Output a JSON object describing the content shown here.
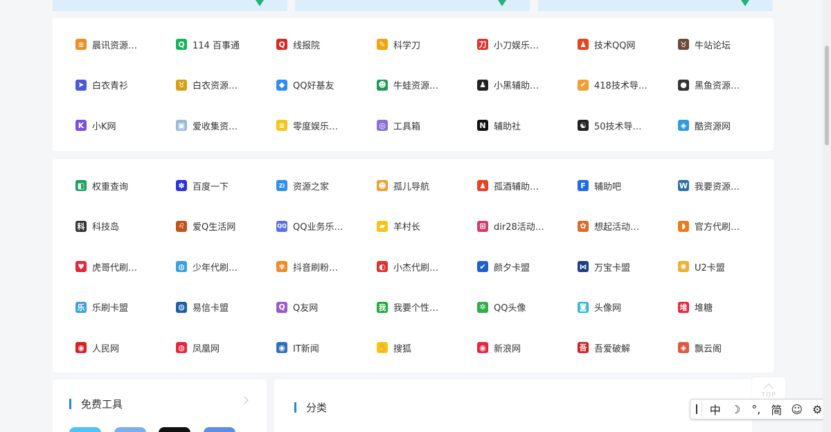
{
  "panel1": {
    "links": [
      {
        "label": "晨讯资源…",
        "icon": "sunrise-icon",
        "color": "#f08a24",
        "glyph": "≋"
      },
      {
        "label": "114 百事通",
        "icon": "circle-q-icon",
        "color": "#16b356",
        "glyph": "Q"
      },
      {
        "label": "线报院",
        "icon": "q-ring-icon",
        "color": "#d9281f",
        "glyph": "Q"
      },
      {
        "label": "科学刀",
        "icon": "pencil-icon",
        "color": "#f2a30f",
        "glyph": "✎"
      },
      {
        "label": "小刀娱乐…",
        "icon": "xiaodao-logo-icon",
        "color": "#e0312a",
        "glyph": "刀"
      },
      {
        "label": "技术QQ网",
        "icon": "penguin-icon",
        "color": "#e8421f",
        "glyph": "♟"
      },
      {
        "label": "牛站论坛",
        "icon": "bull-icon",
        "color": "#6b4a3a",
        "glyph": "♉"
      },
      {
        "label": "白衣青衫",
        "icon": "bird-icon",
        "color": "#4c5bd4",
        "glyph": "➤"
      },
      {
        "label": "白衣资源…",
        "icon": "bull-head-icon",
        "color": "#d4a017",
        "glyph": "♉"
      },
      {
        "label": "QQ好基友",
        "icon": "diamond-icon",
        "color": "#2f8ff0",
        "glyph": "◆"
      },
      {
        "label": "牛蛙资源…",
        "icon": "frog-icon",
        "color": "#1f9a57",
        "glyph": "☻"
      },
      {
        "label": "小黑辅助…",
        "icon": "hooded-figure-icon",
        "color": "#222222",
        "glyph": "♟"
      },
      {
        "label": "418技术导…",
        "icon": "check-badge-icon",
        "color": "#f0a030",
        "glyph": "✔"
      },
      {
        "label": "黑鱼资源…",
        "icon": "black-fish-icon",
        "color": "#333333",
        "glyph": "●"
      },
      {
        "label": "小K网",
        "icon": "k-letter-icon",
        "color": "#7a4ce0",
        "glyph": "K"
      },
      {
        "label": "爱收集资…",
        "icon": "broken-image-icon",
        "color": "#9cb8d8",
        "glyph": "▣"
      },
      {
        "label": "零度娱乐…",
        "icon": "note-icon",
        "color": "#f5c518",
        "glyph": "≡"
      },
      {
        "label": "工具箱",
        "icon": "planet-icon",
        "color": "#8a6fd6",
        "glyph": "◎"
      },
      {
        "label": "辅助社",
        "icon": "n-letter-icon",
        "color": "#111111",
        "glyph": "N"
      },
      {
        "label": "50技术导…",
        "icon": "yin-yang-icon",
        "color": "#222222",
        "glyph": "☯"
      },
      {
        "label": "酷资源网",
        "icon": "cube-icon",
        "color": "#2d9cdb",
        "glyph": "◈"
      }
    ]
  },
  "panel2": {
    "links": [
      {
        "label": "权重查询",
        "icon": "weight-check-icon",
        "color": "#1aa260",
        "glyph": "◧"
      },
      {
        "label": "百度一下",
        "icon": "baidu-paw-icon",
        "color": "#2932e1",
        "glyph": "✽"
      },
      {
        "label": "资源之家",
        "icon": "zi-letter-icon",
        "color": "#2f8ff0",
        "glyph": "Zi"
      },
      {
        "label": "孤儿导航",
        "icon": "tiger-icon",
        "color": "#f0a030",
        "glyph": "☻"
      },
      {
        "label": "孤酒辅助…",
        "icon": "penguin-icon",
        "color": "#e8421f",
        "glyph": "♟"
      },
      {
        "label": "辅助吧",
        "icon": "f-letter-icon",
        "color": "#1e6be8",
        "glyph": "F"
      },
      {
        "label": "我要资源…",
        "icon": "wordpress-icon",
        "color": "#2a6fa8",
        "glyph": "W"
      },
      {
        "label": "科技岛",
        "icon": "tech-island-icon",
        "color": "#333333",
        "glyph": "科"
      },
      {
        "label": "爱Q生活网",
        "icon": "lion-icon",
        "color": "#c0531b",
        "glyph": "♌"
      },
      {
        "label": "QQ业务乐…",
        "icon": "qq-letters-icon",
        "color": "#5a6fe0",
        "glyph": "QQ"
      },
      {
        "label": "羊村长",
        "icon": "sheep-card-icon",
        "color": "#f5c518",
        "glyph": "▰"
      },
      {
        "label": "dir28活动…",
        "icon": "gift-icon",
        "color": "#d63b6b",
        "glyph": "⊞"
      },
      {
        "label": "想起活动…",
        "icon": "pinwheel-icon",
        "color": "#e06a2a",
        "glyph": "✿"
      },
      {
        "label": "官方代刷…",
        "icon": "orange-tag-icon",
        "color": "#f07a18",
        "glyph": "◗"
      },
      {
        "label": "虎哥代刷…",
        "icon": "heart-icon",
        "color": "#e8263a",
        "glyph": "♥"
      },
      {
        "label": "少年代刷…",
        "icon": "globe-badge-icon",
        "color": "#3aa0d8",
        "glyph": "◍"
      },
      {
        "label": "抖音刷粉…",
        "icon": "flower-icon",
        "color": "#f08a24",
        "glyph": "✾"
      },
      {
        "label": "小杰代刷…",
        "icon": "swirl-icon",
        "color": "#e0312a",
        "glyph": "◐"
      },
      {
        "label": "颜夕卡盟",
        "icon": "v-check-icon",
        "color": "#1e5fd0",
        "glyph": "✔"
      },
      {
        "label": "万宝卡盟",
        "icon": "bowtie-icon",
        "color": "#1c3d8a",
        "glyph": "⋈"
      },
      {
        "label": "U2卡盟",
        "icon": "fan-icon",
        "color": "#f0b030",
        "glyph": "✺"
      },
      {
        "label": "乐刷卡盟",
        "icon": "lecard-icon",
        "color": "#3aa0d8",
        "glyph": "乐"
      },
      {
        "label": "易信卡盟",
        "icon": "swoosh-globe-icon",
        "color": "#1e5fa8",
        "glyph": "◍"
      },
      {
        "label": "Q友网",
        "icon": "q-square-icon",
        "color": "#9b59d0",
        "glyph": "Q"
      },
      {
        "label": "我要个性…",
        "icon": "wo-letter-icon",
        "color": "#1fa83a",
        "glyph": "我"
      },
      {
        "label": "QQ头像",
        "icon": "frog-leaf-icon",
        "color": "#2fb04a",
        "glyph": "✲"
      },
      {
        "label": "头像网",
        "icon": "chat-bubble-icon",
        "color": "#2bbcd0",
        "glyph": "◙"
      },
      {
        "label": "堆糖",
        "icon": "duitang-icon",
        "color": "#e8263a",
        "glyph": "堆"
      },
      {
        "label": "人民网",
        "icon": "renmin-logo-icon",
        "color": "#d61f1f",
        "glyph": "◉"
      },
      {
        "label": "凤凰网",
        "icon": "phoenix-icon",
        "color": "#e8263a",
        "glyph": "◍"
      },
      {
        "label": "IT新闻",
        "icon": "rss-icon",
        "color": "#2f6fc0",
        "glyph": "◉"
      },
      {
        "label": "搜狐",
        "icon": "sohu-hand-icon",
        "color": "#f5c518",
        "glyph": "✋"
      },
      {
        "label": "新浪网",
        "icon": "weibo-eye-icon",
        "color": "#e8263a",
        "glyph": "◉"
      },
      {
        "label": "吾爱破解",
        "icon": "52pojie-icon",
        "color": "#d61f1f",
        "glyph": "吾"
      },
      {
        "label": "飘云阁",
        "icon": "shield-icon",
        "color": "#e05a3a",
        "glyph": "◈"
      }
    ]
  },
  "tools": {
    "title": "免费工具"
  },
  "category": {
    "title": "分类"
  },
  "totop": {
    "label": "TOP"
  },
  "ime": {
    "items": [
      "中",
      "☽",
      "°,",
      "简",
      "☺",
      "⚙"
    ]
  }
}
